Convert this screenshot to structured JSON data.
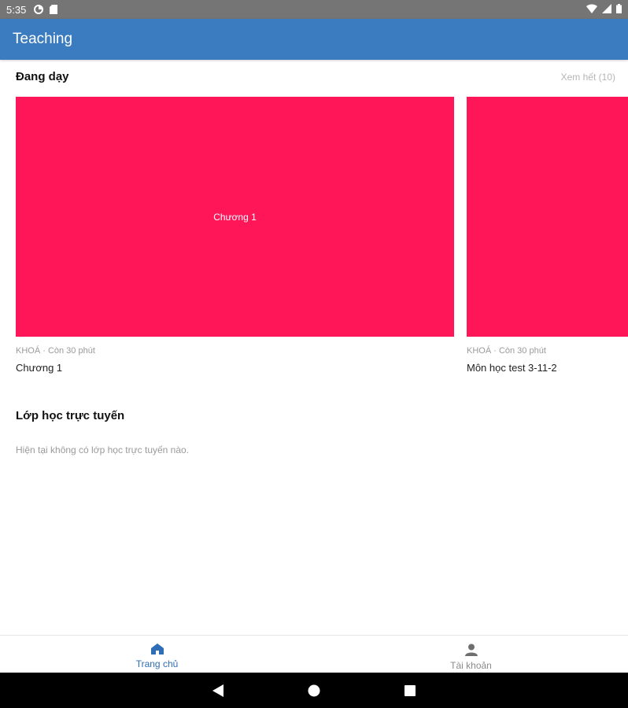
{
  "status_bar": {
    "time": "5:35",
    "icons_left": [
      "data-saver-icon",
      "sd-card-icon"
    ],
    "icons_right": [
      "wifi-icon",
      "signal-icon",
      "battery-icon"
    ]
  },
  "app_bar": {
    "title": "Teaching"
  },
  "teaching_section": {
    "title": "Đang dạy",
    "see_all": "Xem hết (10)"
  },
  "courses": [
    {
      "thumb_label": "Chương 1",
      "meta": "KHOÁ · Còn 30 phút",
      "name": "Chương 1",
      "color": "#fe1659"
    },
    {
      "thumb_label": "",
      "meta": "KHOÁ · Còn 30 phút",
      "name": "Môn học test 3-11-2",
      "color": "#fe1659"
    }
  ],
  "online_section": {
    "title": "Lớp học trực tuyến",
    "empty_text": "Hiện tại không có lớp học trực tuyến nào."
  },
  "bottom_nav": [
    {
      "label": "Trang chủ",
      "icon": "home-icon",
      "active": true
    },
    {
      "label": "Tài khoản",
      "icon": "person-icon",
      "active": false
    }
  ],
  "colors": {
    "app_bar": "#3b7bbf",
    "accent": "#fe1659",
    "nav_active": "#2f6db5"
  }
}
